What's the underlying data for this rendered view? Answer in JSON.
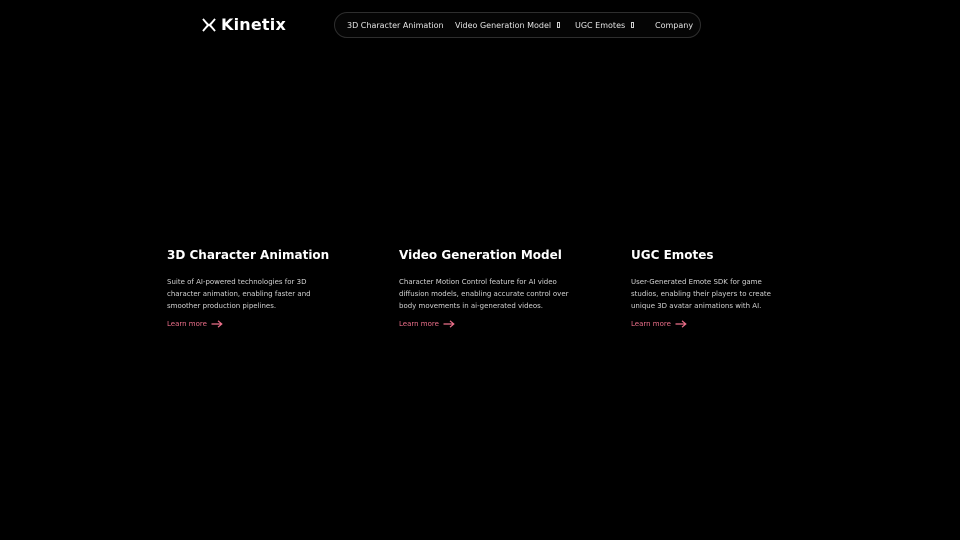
{
  "brand": {
    "name": "Kinetix",
    "logo_icon": "kinetix-x-icon"
  },
  "nav": {
    "items": [
      {
        "label": "3D Character Animation",
        "has_dropdown": false
      },
      {
        "label": "Video Generation Model",
        "has_dropdown": true
      },
      {
        "label": "UGC Emotes",
        "has_dropdown": true
      },
      {
        "label": "Company",
        "has_dropdown": false
      }
    ]
  },
  "cards": [
    {
      "title": "3D Character Animation",
      "description": "Suite of AI-powered technologies for 3D character animation, enabling faster and smoother production pipelines.",
      "link_label": "Learn more"
    },
    {
      "title": "Video Generation Model",
      "description": "Character Motion Control feature for AI video diffusion models, enabling accurate control over body movements in ai-generated videos.",
      "link_label": "Learn more"
    },
    {
      "title": "UGC Emotes",
      "description": "User-Generated Emote SDK for game studios, enabling their players to create unique 3D avatar animations with AI.",
      "link_label": "Learn more"
    }
  ],
  "colors": {
    "background": "#000000",
    "accent": "#ec6f8a",
    "text": "#ffffff",
    "muted_text": "#d4d4d4"
  }
}
